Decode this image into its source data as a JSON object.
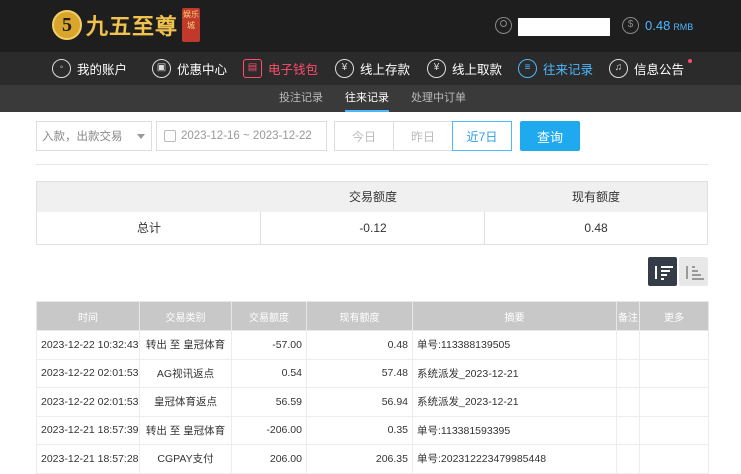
{
  "brand": {
    "logo_numeral": "5",
    "name": "九五至尊",
    "badge": "娱乐城"
  },
  "account": {
    "balance": "0.48",
    "currency": "RMB"
  },
  "nav": [
    {
      "label": "我的账户",
      "icon": "user-icon"
    },
    {
      "label": "优惠中心",
      "icon": "gift-icon"
    },
    {
      "label": "电子钱包",
      "icon": "wallet-icon"
    },
    {
      "label": "线上存款",
      "icon": "deposit-icon"
    },
    {
      "label": "线上取款",
      "icon": "withdraw-icon"
    },
    {
      "label": "往来记录",
      "icon": "records-icon"
    },
    {
      "label": "信息公告",
      "icon": "bell-icon"
    }
  ],
  "subnav": [
    {
      "label": "投注记录"
    },
    {
      "label": "往来记录"
    },
    {
      "label": "处理中订单"
    }
  ],
  "filters": {
    "type_select": "入款，出款交易",
    "date_range": "2023-12-16 ~ 2023-12-22",
    "quick": [
      "今日",
      "昨日",
      "近7日"
    ],
    "search": "查询"
  },
  "summary": {
    "headers": [
      "交易额度",
      "现有额度"
    ],
    "label": "总计",
    "amount": "-0.12",
    "balance": "0.48"
  },
  "table": {
    "headers": [
      "时间",
      "交易类别",
      "交易额度",
      "现有额度",
      "摘要",
      "备注",
      "更多"
    ],
    "rows": [
      [
        "2023-12-22 10:32:43",
        "转出 至 皇冠体育",
        "-57.00",
        "0.48",
        "单号:113388139505",
        "",
        ""
      ],
      [
        "2023-12-22 02:01:53",
        "AG视讯返点",
        "0.54",
        "57.48",
        "系统派发_2023-12-21",
        "",
        ""
      ],
      [
        "2023-12-22 02:01:53",
        "皇冠体育返点",
        "56.59",
        "56.94",
        "系统派发_2023-12-21",
        "",
        ""
      ],
      [
        "2023-12-21 18:57:39",
        "转出 至 皇冠体育",
        "-206.00",
        "0.35",
        "单号:113381593395",
        "",
        ""
      ],
      [
        "2023-12-21 18:57:28",
        "CGPAY支付",
        "206.00",
        "206.35",
        "单号:202312223479985448",
        "",
        ""
      ]
    ]
  },
  "colors": {
    "accent": "#1faaf0",
    "active_red": "#ff4d6d",
    "header_bg": "#1e1e1e"
  }
}
